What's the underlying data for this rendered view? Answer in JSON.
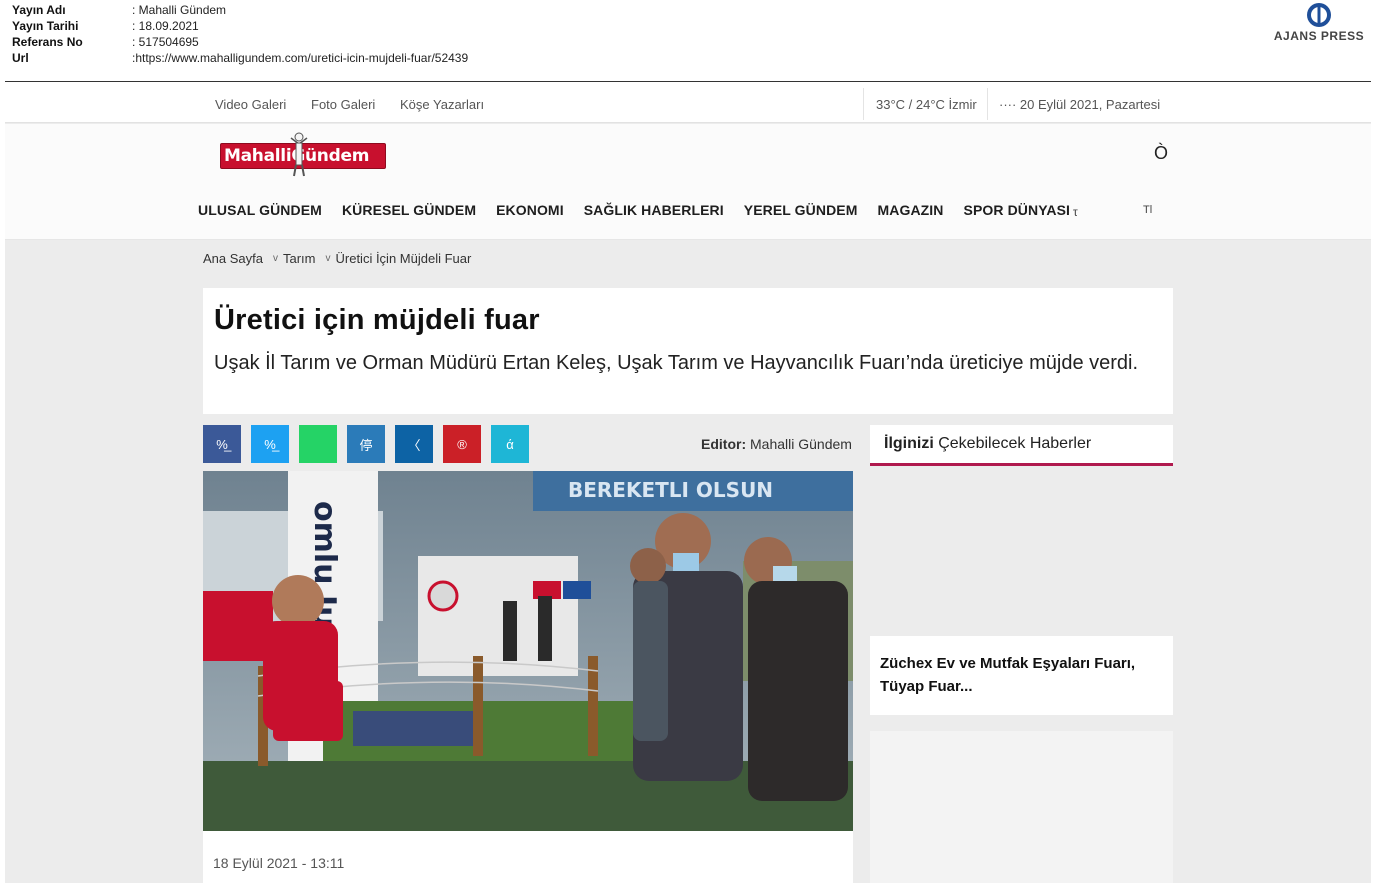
{
  "clip": {
    "rows": [
      {
        "label": "Yayın Adı",
        "value": ": Mahalli Gündem"
      },
      {
        "label": "Yayın Tarihi",
        "value": ": 18.09.2021"
      },
      {
        "label": "Referans No",
        "value": ": 517504695"
      },
      {
        "label": "Url",
        "value": ":https://www.mahalligundem.com/uretici-icin-mujdeli-fuar/52439"
      }
    ],
    "agency": "AJANS PRESS"
  },
  "topbar": {
    "links": [
      "Video Galeri",
      "Foto Galeri",
      "Köşe Yazarları"
    ],
    "weather": "33°C / 24°C İzmir",
    "date": "···· 20 Eylül 2021, Pazartesi"
  },
  "header": {
    "logo_text": "MahalliGündem",
    "search_icon": "Ò",
    "nav": [
      "ULUSAL GÜNDEM",
      "KÜRESEL GÜNDEM",
      "EKONOMI",
      "SAĞLIK HABERLERI",
      "YEREL GÜNDEM",
      "MAGAZIN",
      "SPOR DÜNYASI"
    ],
    "nav_more": "τ",
    "nav_toggle": "Tl"
  },
  "breadcrumb": {
    "home": "Ana Sayfa",
    "chev": "v",
    "category": "Tarım",
    "current": "Üretici İçin Müjdeli Fuar"
  },
  "article": {
    "title": "Üretici için müjdeli fuar",
    "summary": "Uşak İl Tarım ve Orman Müdürü Ertan Keleş, Uşak Tarım ve Hayvancılık Fuarı’nda üreticiye müjde verdi.",
    "editor_label": "Editor:",
    "editor_name": "Mahalli Gündem",
    "date": "18 Eylül 2021 - 13:11",
    "banner_text": "BEREKETLI OLSUN",
    "sign_text": "omlu Jusnl"
  },
  "share": [
    {
      "name": "facebook",
      "glyph": "%̲",
      "color": "#3b5998"
    },
    {
      "name": "twitter",
      "glyph": "%̲",
      "color": "#1da1f2"
    },
    {
      "name": "whatsapp",
      "glyph": "",
      "color": "#25d366"
    },
    {
      "name": "linkedin",
      "glyph": "停",
      "color": "#2b7bb9"
    },
    {
      "name": "telegram",
      "glyph": "〈",
      "color": "#0d63a5"
    },
    {
      "name": "pinterest",
      "glyph": "®",
      "color": "#cb2027"
    },
    {
      "name": "email",
      "glyph": "ά",
      "color": "#1eb6d6"
    }
  ],
  "sidebar": {
    "head_bold": "İlginizi",
    "head_rest": " Çekebilecek Haberler",
    "news_title": "Züchex Ev ve Mutfak Eşyaları Fuarı, Tüyap Fuar..."
  }
}
